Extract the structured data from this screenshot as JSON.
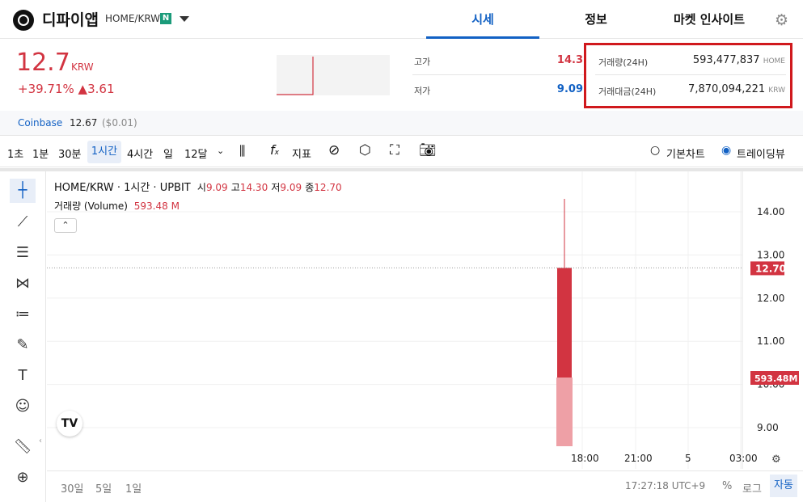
{
  "header": {
    "coin_name": "디파이앱",
    "pair": "HOME/KRW",
    "badge": "N",
    "tabs": [
      "시세",
      "정보",
      "마켓 인사이트"
    ]
  },
  "price": {
    "value": "12.7",
    "unit": "KRW",
    "change_pct": "+39.71%",
    "change_abs": "▲3.61"
  },
  "stats": {
    "high_label": "고가",
    "high_value": "14.3",
    "low_label": "저가",
    "low_value": "9.09",
    "vol_label": "거래량(24H)",
    "vol_value": "593,477,837",
    "vol_unit": "HOME",
    "amt_label": "거래대금(24H)",
    "amt_value": "7,870,094,221",
    "amt_unit": "KRW"
  },
  "exchange_line": {
    "name": "Coinbase",
    "price": "12.67",
    "usd": "($0.01)"
  },
  "toolbar": {
    "intervals": [
      "1초",
      "1분",
      "30분",
      "1시간",
      "4시간",
      "일",
      "12달"
    ],
    "indicator_label": "지표",
    "basic_chart": "기본차트",
    "tradingview": "트레이딩뷰"
  },
  "legend": {
    "title": "HOME/KRW · 1시간 · UPBIT",
    "o_label": "시",
    "o": "9.09",
    "h_label": "고",
    "h": "14.30",
    "l_label": "저",
    "l": "9.09",
    "c_label": "종",
    "c": "12.70",
    "vol_label": "거래량 (Volume)",
    "vol": "593.48 M"
  },
  "chart_data": {
    "type": "candlestick",
    "y_ticks": [
      "14.00",
      "13.00",
      "12.00",
      "11.00",
      "10.00",
      "9.00"
    ],
    "x_ticks": [
      "18:00",
      "21:00",
      "5",
      "03:00"
    ],
    "candles": [
      {
        "open": 9.09,
        "high": 14.3,
        "low": 9.09,
        "close": 12.7
      }
    ],
    "last_price_label": "12.70",
    "volume_label": "593.48 M",
    "colors": {
      "up": "#d23441",
      "volume": "#eea0a6"
    }
  },
  "bottom": {
    "ranges": [
      "30일",
      "5일",
      "1일"
    ],
    "time": "17:27:18 UTC+9",
    "percent": "%",
    "log": "로그",
    "auto": "자동"
  }
}
